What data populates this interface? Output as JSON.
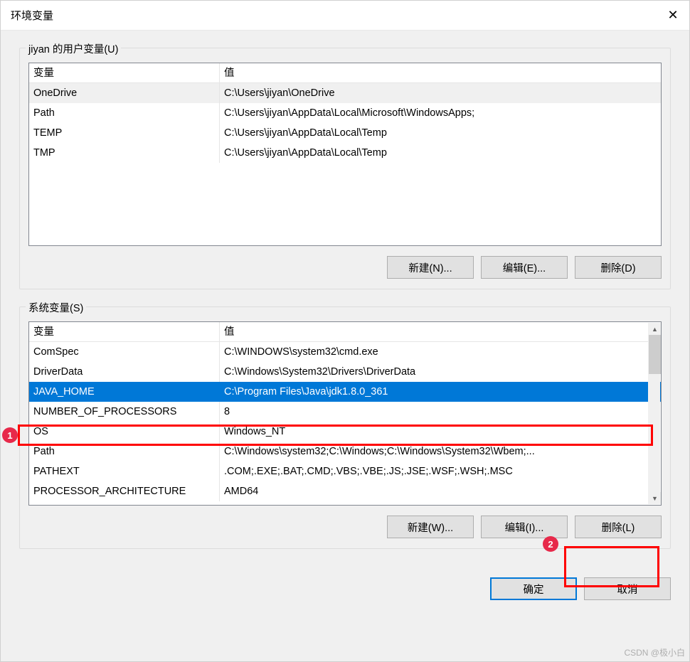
{
  "window": {
    "title": "环境变量"
  },
  "user_section": {
    "label": "jiyan 的用户变量(U)",
    "headers": {
      "name": "变量",
      "value": "值"
    },
    "rows": [
      {
        "name": "OneDrive",
        "value": "C:\\Users\\jiyan\\OneDrive"
      },
      {
        "name": "Path",
        "value": "C:\\Users\\jiyan\\AppData\\Local\\Microsoft\\WindowsApps;"
      },
      {
        "name": "TEMP",
        "value": "C:\\Users\\jiyan\\AppData\\Local\\Temp"
      },
      {
        "name": "TMP",
        "value": "C:\\Users\\jiyan\\AppData\\Local\\Temp"
      }
    ],
    "buttons": {
      "new": "新建(N)...",
      "edit": "编辑(E)...",
      "delete": "删除(D)"
    }
  },
  "system_section": {
    "label": "系统变量(S)",
    "headers": {
      "name": "变量",
      "value": "值"
    },
    "rows": [
      {
        "name": "ComSpec",
        "value": "C:\\WINDOWS\\system32\\cmd.exe"
      },
      {
        "name": "DriverData",
        "value": "C:\\Windows\\System32\\Drivers\\DriverData"
      },
      {
        "name": "JAVA_HOME",
        "value": "C:\\Program Files\\Java\\jdk1.8.0_361",
        "selected": true
      },
      {
        "name": "NUMBER_OF_PROCESSORS",
        "value": "8"
      },
      {
        "name": "OS",
        "value": "Windows_NT"
      },
      {
        "name": "Path",
        "value": "C:\\Windows\\system32;C:\\Windows;C:\\Windows\\System32\\Wbem;..."
      },
      {
        "name": "PATHEXT",
        "value": ".COM;.EXE;.BAT;.CMD;.VBS;.VBE;.JS;.JSE;.WSF;.WSH;.MSC"
      },
      {
        "name": "PROCESSOR_ARCHITECTURE",
        "value": "AMD64"
      }
    ],
    "buttons": {
      "new": "新建(W)...",
      "edit": "编辑(I)...",
      "delete": "删除(L)"
    }
  },
  "dialog_buttons": {
    "ok": "确定",
    "cancel": "取消"
  },
  "annotations": {
    "badge1": "1",
    "badge2": "2"
  },
  "watermark": "CSDN @极小白"
}
